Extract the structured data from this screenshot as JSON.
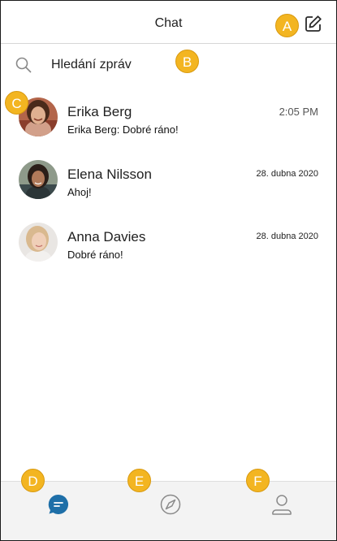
{
  "header": {
    "title": "Chat"
  },
  "search": {
    "placeholder": "Hledání zpráv"
  },
  "chats": [
    {
      "name": "Erika Berg",
      "preview": "Erika Berg: Dobré ráno!",
      "time": "2:05 PM"
    },
    {
      "name": "Elena  Nilsson",
      "preview": "Ahoj!",
      "time": "28. dubna 2020"
    },
    {
      "name": "Anna  Davies",
      "preview": "Dobré ráno!",
      "time": "28. dubna 2020"
    }
  ],
  "tabs": [
    {
      "id": "chat",
      "icon": "chat-icon",
      "active": true
    },
    {
      "id": "discover",
      "icon": "compass-icon",
      "active": false
    },
    {
      "id": "profile",
      "icon": "person-icon",
      "active": false
    }
  ],
  "callouts": {
    "a": "A",
    "b": "B",
    "c": "C",
    "d": "D",
    "e": "E",
    "f": "F"
  },
  "colors": {
    "accent": "#1e6fa8",
    "callout": "#f3b521",
    "tabbar": "#f3f3f3",
    "icon": "#8a8a8a"
  }
}
